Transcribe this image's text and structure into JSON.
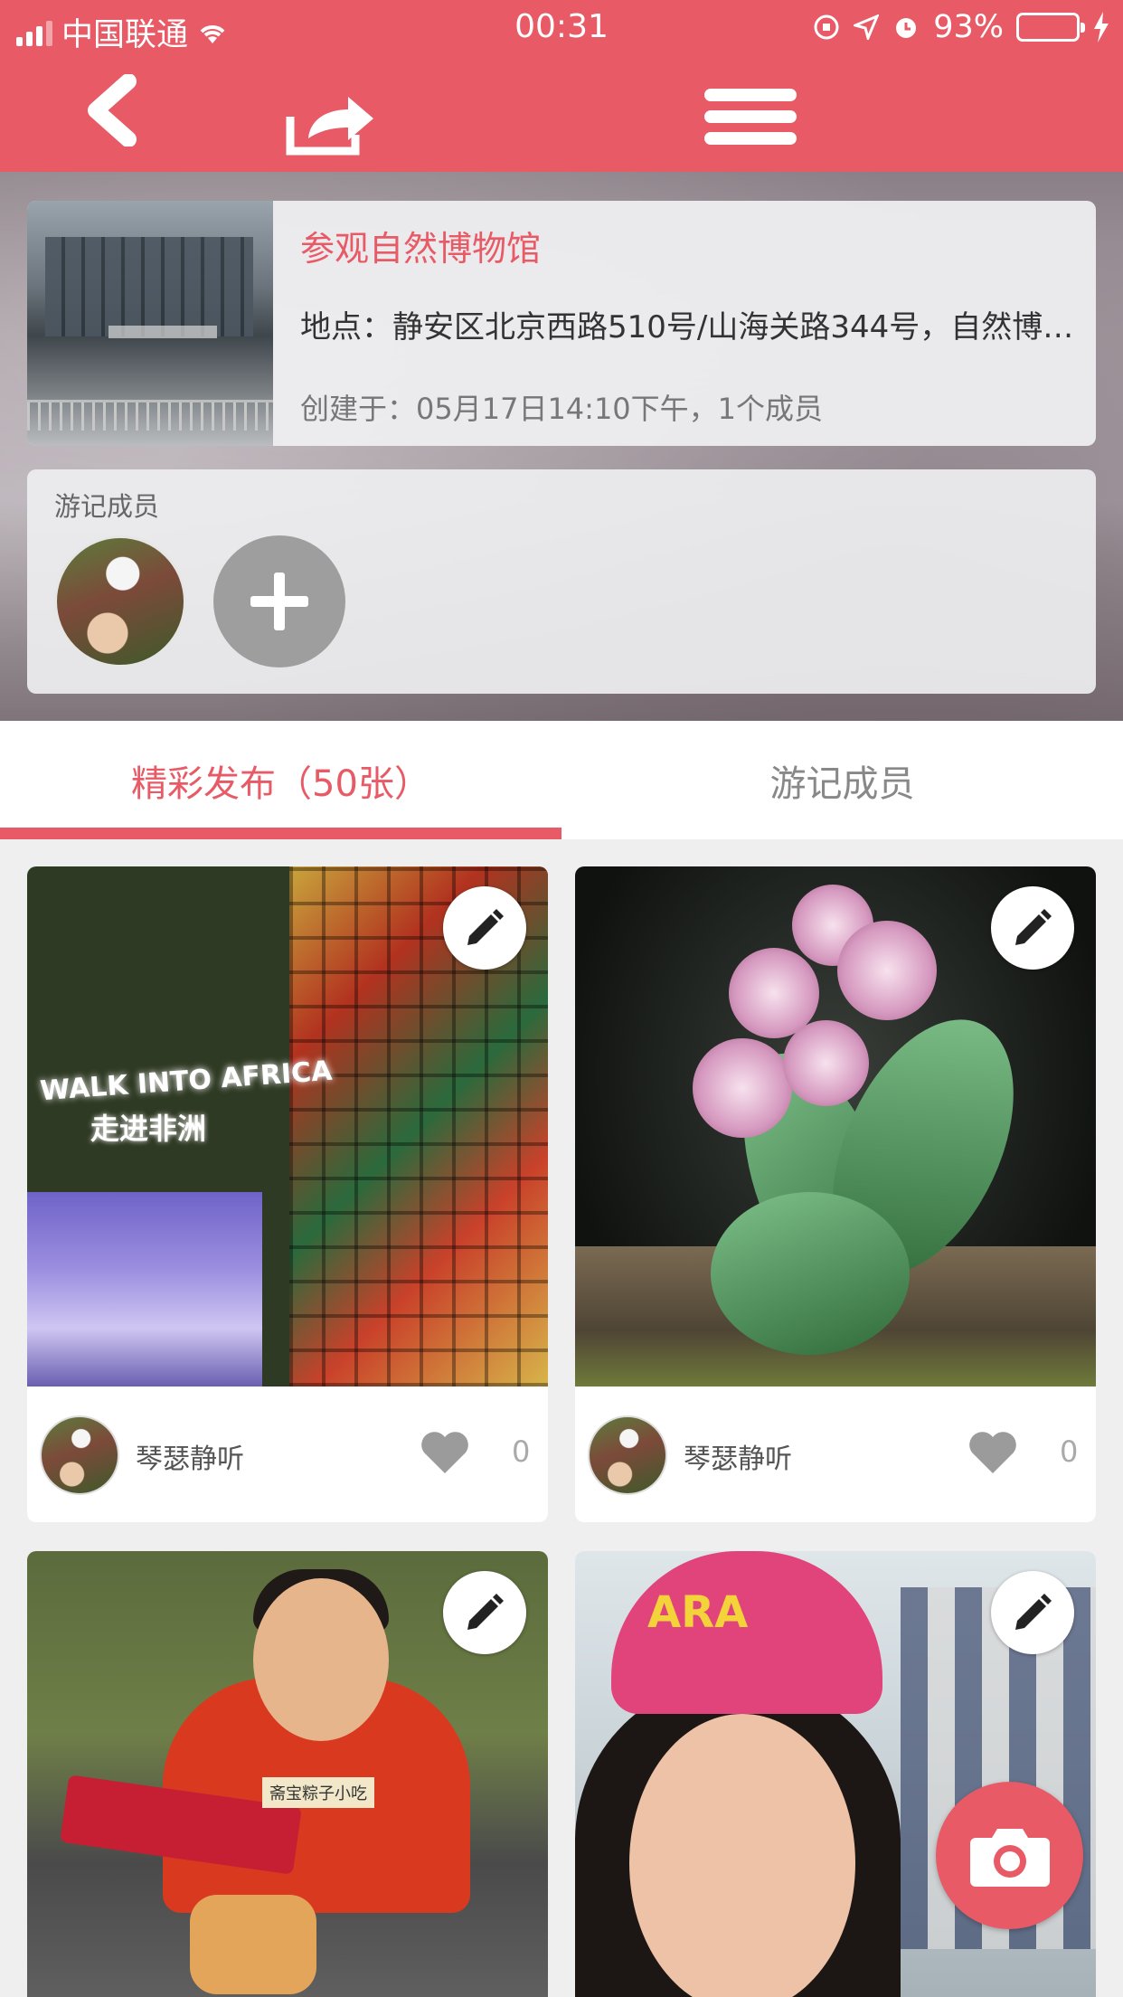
{
  "status_bar": {
    "carrier": "中国联通",
    "time": "00:31",
    "battery_percent": "93%",
    "battery_level": 0.93
  },
  "nav": {
    "back_icon": "chevron-left-icon",
    "share_icon": "share-icon",
    "menu_icon": "hamburger-menu-icon"
  },
  "trip": {
    "title": "参观自然博物馆",
    "location": "地点：静安区北京西路510号/山海关路344号，自然博物馆",
    "created": "创建于：05月17日14:10下午，1个成员"
  },
  "members": {
    "label": "游记成员",
    "add_icon": "plus-icon"
  },
  "tabs": [
    {
      "label": "精彩发布（50张）",
      "active": true
    },
    {
      "label": "游记成员",
      "active": false
    }
  ],
  "posts": [
    {
      "author": "琴瑟静听",
      "likes": "0",
      "image": "africa-exhibit",
      "sign_text": "WALK INTO AFRICA",
      "sign_cn": "走进非洲"
    },
    {
      "author": "琴瑟静听",
      "likes": "0",
      "image": "orchid"
    },
    {
      "image": "boy-eating",
      "snack_label": "斋宝粽子小吃"
    },
    {
      "image": "woman-selfie",
      "cap_text": "ARA"
    }
  ],
  "colors": {
    "accent": "#e85a65",
    "status_battery": "#4cd964"
  }
}
